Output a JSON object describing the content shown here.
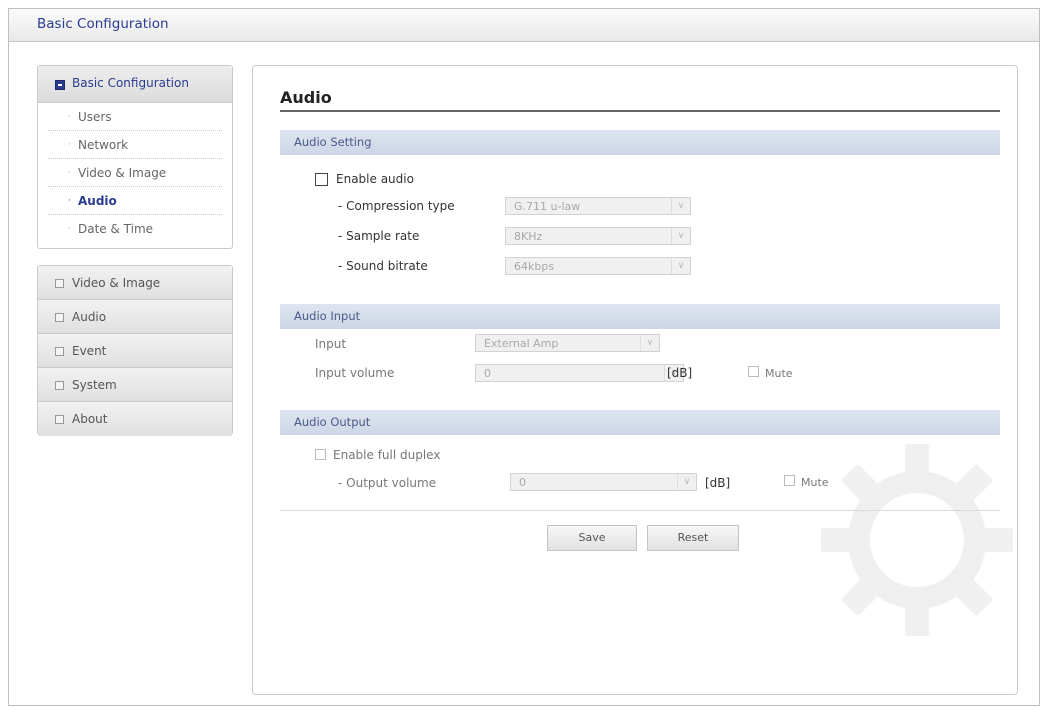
{
  "app": {
    "title": "Basic Configuration"
  },
  "sidebar": {
    "basic": {
      "label": "Basic Configuration",
      "items": [
        {
          "label": "Users"
        },
        {
          "label": "Network"
        },
        {
          "label": "Video & Image"
        },
        {
          "label": "Audio"
        },
        {
          "label": "Date & Time"
        }
      ]
    },
    "groups": [
      {
        "label": "Video & Image"
      },
      {
        "label": "Audio"
      },
      {
        "label": "Event"
      },
      {
        "label": "System"
      },
      {
        "label": "About"
      }
    ]
  },
  "main": {
    "title": "Audio",
    "audio_setting": {
      "header": "Audio Setting",
      "enable_label": "Enable audio",
      "compression_label": "- Compression type",
      "compression_value": "G.711 u-law",
      "sample_rate_label": "- Sample rate",
      "sample_rate_value": "8KHz",
      "bitrate_label": "- Sound bitrate",
      "bitrate_value": "64kbps"
    },
    "audio_input": {
      "header": "Audio Input",
      "input_label": "Input",
      "input_value": "External Amp",
      "volume_label": "Input volume",
      "volume_value": "0",
      "unit": "[dB]",
      "mute_label": "Mute"
    },
    "audio_output": {
      "header": "Audio Output",
      "duplex_label": "Enable full duplex",
      "volume_label": "- Output volume",
      "volume_value": "0",
      "unit": "[dB]",
      "mute_label": "Mute"
    },
    "buttons": {
      "save": "Save",
      "reset": "Reset"
    }
  },
  "icons": {
    "decor": "gear-icon",
    "dropdown": "chevron-down-icon"
  },
  "colors": {
    "accent": "#2a3c8f",
    "section_bg": "#d6deeb"
  }
}
